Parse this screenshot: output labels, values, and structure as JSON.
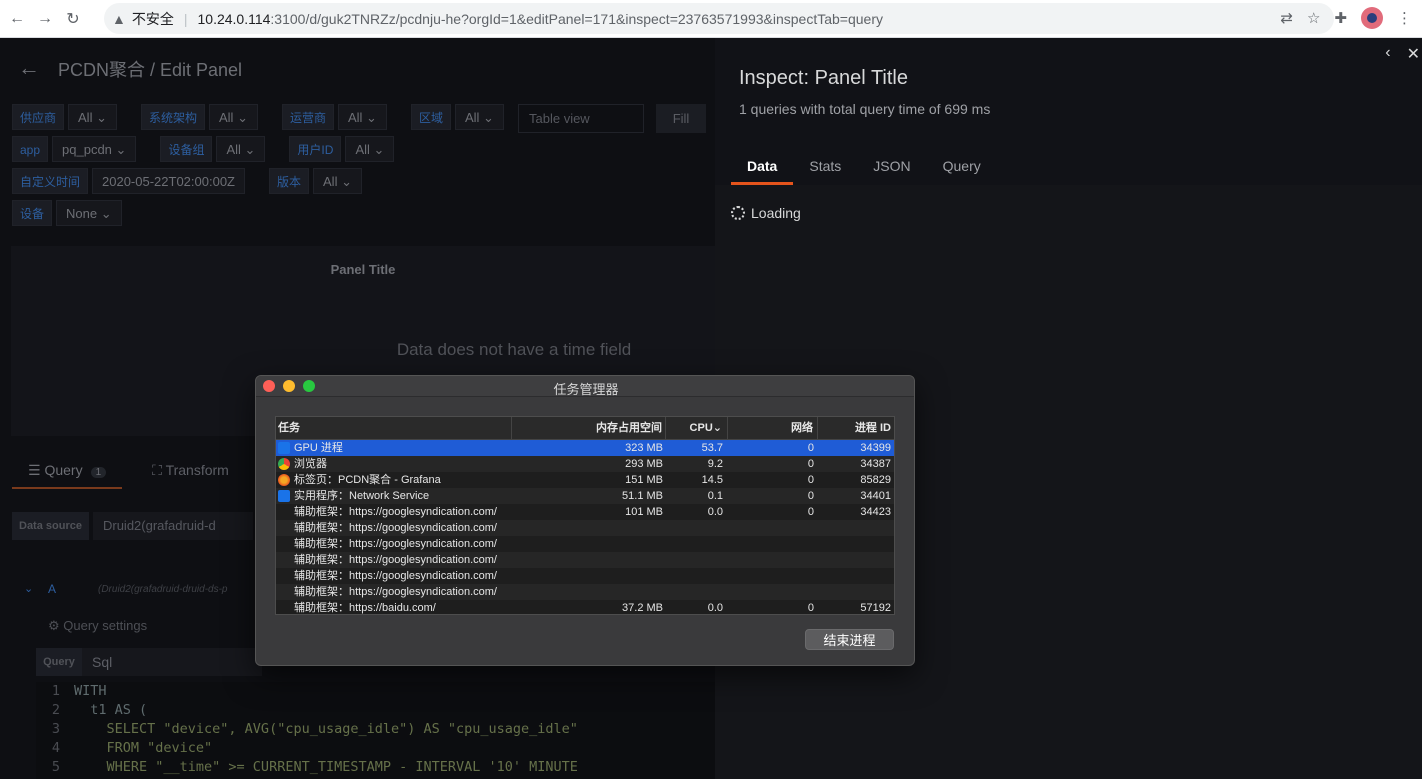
{
  "browser": {
    "insecure_label": "不安全",
    "url_host": "10.24.0.114",
    "url_path": ":3100/d/guk2TNRZz/pcdnju-he?orgId=1&editPanel=171&inspect=23763571993&inspectTab=query"
  },
  "grafana": {
    "page_title": "PCDN聚合 / Edit Panel",
    "variables_row1": [
      {
        "label": "供应商",
        "value": "All"
      },
      {
        "label": "系统架构",
        "value": "All"
      },
      {
        "label": "运营商",
        "value": "All"
      },
      {
        "label": "区域",
        "value": "All"
      }
    ],
    "variables_row2": [
      {
        "label": "app",
        "value": "pq_pcdn"
      },
      {
        "label": "设备组",
        "value": "All"
      },
      {
        "label": "用户ID",
        "value": "All"
      }
    ],
    "variables_row3": [
      {
        "label": "自定义时间",
        "value": "2020-05-22T02:00:00Z"
      },
      {
        "label": "版本",
        "value": "All"
      }
    ],
    "variables_row4": [
      {
        "label": "设备",
        "value": "None"
      }
    ],
    "table_view_label": "Table view",
    "fill_label": "Fill",
    "panel_title": "Panel Title",
    "no_time_msg": "Data does not have a time field",
    "tab_query": "Query",
    "tab_query_count": "1",
    "tab_transform": "Transform",
    "datasource_label": "Data source",
    "datasource_value": "Druid2(grafadruid-d",
    "query_letter": "A",
    "query_ds": "(Druid2(grafadruid-druid-ds-p",
    "query_settings": "Query settings",
    "query_type_label": "Query",
    "query_type_value": "Sql",
    "code": [
      {
        "n": "1",
        "text": "WITH"
      },
      {
        "n": "2",
        "text": "  t1 AS ("
      },
      {
        "n": "3",
        "text": "    SELECT \"device\", AVG(\"cpu_usage_idle\") AS \"cpu_usage_idle\""
      },
      {
        "n": "4",
        "text": "    FROM \"device\""
      },
      {
        "n": "5",
        "text": "    WHERE \"__time\" >= CURRENT_TIMESTAMP - INTERVAL '10' MINUTE"
      }
    ]
  },
  "inspect": {
    "title": "Inspect: Panel Title",
    "subtitle": "1 queries with total query time of 699 ms",
    "tabs": [
      "Data",
      "Stats",
      "JSON",
      "Query"
    ],
    "loading": "Loading"
  },
  "task_manager": {
    "title": "任务管理器",
    "headers": [
      "任务",
      "内存占用空间",
      "CPU⌄",
      "网络",
      "进程 ID"
    ],
    "rows": [
      {
        "icon": "puzzle-icon",
        "name": "GPU 进程",
        "mem": "323 MB",
        "cpu": "53.7",
        "net": "0",
        "pid": "34399"
      },
      {
        "icon": "chrome-icon",
        "name": "浏览器",
        "mem": "293 MB",
        "cpu": "9.2",
        "net": "0",
        "pid": "34387"
      },
      {
        "icon": "grafana-icon",
        "name": "标签页：PCDN聚合 - Grafana",
        "mem": "151 MB",
        "cpu": "14.5",
        "net": "0",
        "pid": "85829"
      },
      {
        "icon": "puzzle-icon",
        "name": "实用程序：Network Service",
        "mem": "51.1 MB",
        "cpu": "0.1",
        "net": "0",
        "pid": "34401"
      },
      {
        "icon": "",
        "name": "辅助框架：https://googlesyndication.com/",
        "mem": "101 MB",
        "cpu": "0.0",
        "net": "0",
        "pid": "34423"
      },
      {
        "icon": "",
        "name": "辅助框架：https://googlesyndication.com/",
        "mem": "",
        "cpu": "",
        "net": "",
        "pid": ""
      },
      {
        "icon": "",
        "name": "辅助框架：https://googlesyndication.com/",
        "mem": "",
        "cpu": "",
        "net": "",
        "pid": ""
      },
      {
        "icon": "",
        "name": "辅助框架：https://googlesyndication.com/",
        "mem": "",
        "cpu": "",
        "net": "",
        "pid": ""
      },
      {
        "icon": "",
        "name": "辅助框架：https://googlesyndication.com/",
        "mem": "",
        "cpu": "",
        "net": "",
        "pid": ""
      },
      {
        "icon": "",
        "name": "辅助框架：https://googlesyndication.com/",
        "mem": "",
        "cpu": "",
        "net": "",
        "pid": ""
      },
      {
        "icon": "",
        "name": "辅助框架：https://baidu.com/",
        "mem": "37.2 MB",
        "cpu": "0.0",
        "net": "0",
        "pid": "57192"
      }
    ],
    "end_process": "结束进程"
  }
}
